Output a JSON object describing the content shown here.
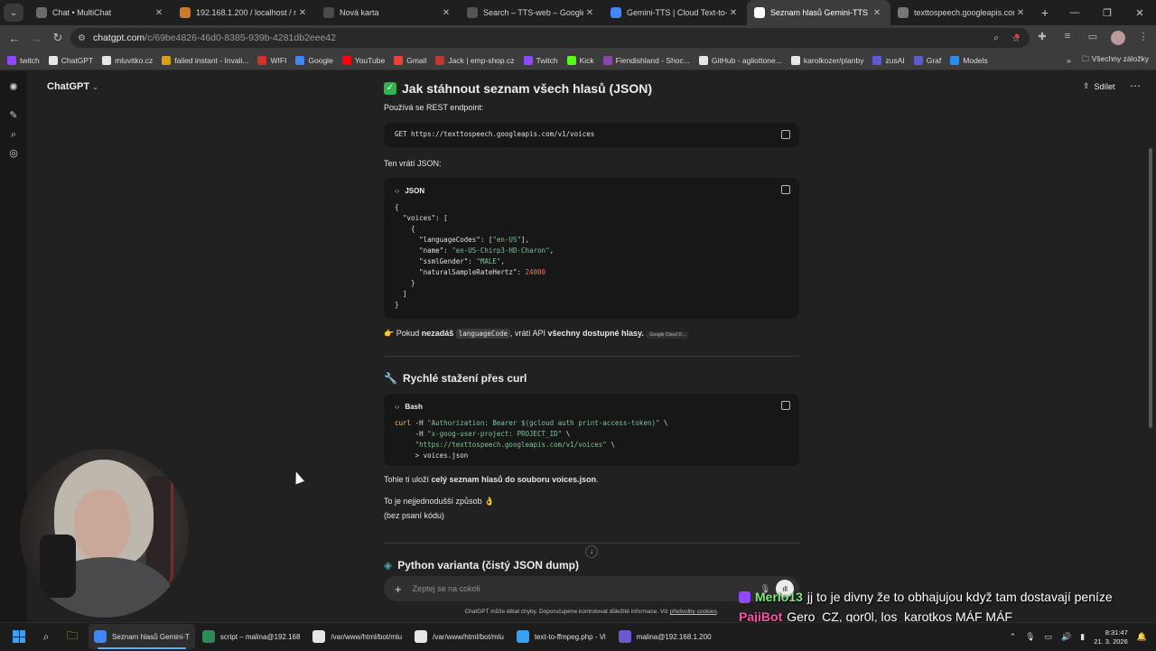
{
  "browser": {
    "tabs": [
      {
        "title": "Chat • MultiChat",
        "color": "#6b6b6b",
        "active": false
      },
      {
        "title": "192.168.1.200 / localhost / mlu",
        "color": "#c97b2b",
        "active": false
      },
      {
        "title": "Nová karta",
        "color": "#4a4a4a",
        "active": false
      },
      {
        "title": "Search – TTS-web – Google Clo",
        "color": "#555555",
        "active": false
      },
      {
        "title": "Gemini-TTS | Cloud Text-to-Sp",
        "color": "#4285f4",
        "active": false
      },
      {
        "title": "Seznam hlasů Gemini-TTS",
        "color": "#ffffff",
        "active": true
      },
      {
        "title": "texttospeech.googleapis.com/v",
        "color": "#777777",
        "active": false
      }
    ],
    "url_host": "chatgpt.com",
    "url_path": "/c/69be4826-46d0-8385-939b-4281db2eee42",
    "bookmarks": [
      {
        "label": "twitch",
        "color": "#9147ff"
      },
      {
        "label": "ChatGPT",
        "color": "#e6e6e6"
      },
      {
        "label": "mluvitko.cz",
        "color": "#e6e6e6"
      },
      {
        "label": "failed instant - Invali...",
        "color": "#d4a017"
      },
      {
        "label": "WIFI",
        "color": "#d93025"
      },
      {
        "label": "Google",
        "color": "#4285f4"
      },
      {
        "label": "YouTube",
        "color": "#ff0000"
      },
      {
        "label": "Gmail",
        "color": "#ea4335"
      },
      {
        "label": "Jack | emp-shop.cz",
        "color": "#c0392b"
      },
      {
        "label": "Twitch",
        "color": "#9147ff"
      },
      {
        "label": "Kick",
        "color": "#53fc18"
      },
      {
        "label": "Fiendishland - Shoc...",
        "color": "#8e44ad"
      },
      {
        "label": "GitHub - agliottone...",
        "color": "#e6e6e6"
      },
      {
        "label": "karolkozer/planby",
        "color": "#e6e6e6"
      },
      {
        "label": "zusAI",
        "color": "#5b5bd6"
      },
      {
        "label": "Graf",
        "color": "#5b5bd6"
      },
      {
        "label": "Models",
        "color": "#2d8cf0"
      }
    ],
    "bookmarks_more": "»",
    "all_bookmarks": "Všechny záložky"
  },
  "chatgpt": {
    "model_title": "ChatGPT",
    "share_label": "Sdílet",
    "sections": {
      "json_heading": "Jak stáhnout seznam všech hlasů (JSON)",
      "json_intro": "Používá se REST endpoint:",
      "endpoint_code": "GET https://texttospeech.googleapis.com/v1/voices",
      "returns_label": "Ten vrátí JSON:",
      "json_lang": "JSON",
      "json_code": {
        "l1": "{",
        "l2": "  \"voices\": [",
        "l3": "    {",
        "l4_key": "      \"languageCodes\": [",
        "l4_val": "\"en-US\"",
        "l4_end": "],",
        "l5_key": "      \"name\": ",
        "l5_val": "\"en-US-Chirp3-HD-Charon\"",
        "l5_end": ",",
        "l6_key": "      \"ssmlGender\": ",
        "l6_val": "\"MALE\"",
        "l6_end": ",",
        "l7_key": "      \"naturalSampleRateHertz\": ",
        "l7_val": "24000",
        "l8": "    }",
        "l9": "  ]",
        "l10": "}"
      },
      "note_prefix": "Pokud ",
      "note_bold1": "nezadáš",
      "note_code": "languageCode",
      "note_mid": ", vrátí API ",
      "note_bold2": "všechny dostupné hlasy.",
      "note_chip": "Google Cloud D...",
      "curl_heading": "Rychlé stažení přes curl",
      "bash_lang": "Bash",
      "bash_code": {
        "l1_cmd": "curl",
        "l1_flag": " -H ",
        "l1_str": "\"Authorization: Bearer $(gcloud auth print-access-token)\"",
        "l1_end": " \\",
        "l2_flag": "     -H ",
        "l2_str": "\"x-goog-user-project: PROJECT_ID\"",
        "l2_end": " \\",
        "l3_str": "     \"https://texttospeech.googleapis.com/v1/voices\"",
        "l3_end": " \\",
        "l4": "     > voices.json"
      },
      "save_prefix": "Tohle ti uloží ",
      "save_bold": "celý seznam hlasů do souboru voices.json",
      "save_end": ".",
      "simple_line1": "To je nejjednodušší způsob 👌",
      "simple_line2": "(bez psaní kódu)",
      "python_heading": "Python varianta (čistý JSON dump)"
    },
    "composer_placeholder": "Zeptej se na cokoli",
    "disclaimer_text": "ChatGPT může dělat chyby. Doporučujeme kontrolovat důležité informace. Viz ",
    "disclaimer_link": "předvolby cookies",
    "disclaimer_end": "."
  },
  "stream_chat": [
    {
      "user": "Merlo13",
      "user_color": "#7fe37f",
      "message": "jj to je divny že to obhajujou když tam dostavají peníze",
      "badge": true
    },
    {
      "user": "PajiBot",
      "user_color": "#ff4fa3",
      "message": "Gero_CZ, gor0l, los_karotkos MÁF MÁF",
      "badge": false
    }
  ],
  "taskbar": {
    "apps": [
      {
        "label": "Seznam hlasů Gemini-T",
        "color": "#4285f4",
        "active": true
      },
      {
        "label": "script – malina@192.168",
        "color": "#2e8b57",
        "active": false
      },
      {
        "label": "/var/www/html/bot/mlu",
        "color": "#e6e6e6",
        "active": false
      },
      {
        "label": "/var/www/html/bot/mlu",
        "color": "#e6e6e6",
        "active": false
      },
      {
        "label": "text-to-ffmpeg.php - Vi",
        "color": "#3aa0f2",
        "active": false
      },
      {
        "label": "malina@192.168.1.200",
        "color": "#6a5acd",
        "active": false
      }
    ],
    "time": "8:31:47",
    "date": "21. 3. 2026"
  }
}
